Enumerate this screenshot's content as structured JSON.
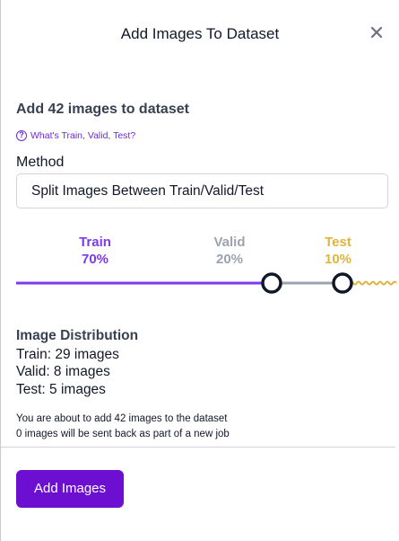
{
  "dialog": {
    "title": "Add Images To Dataset",
    "close_label": "×"
  },
  "heading": "Add 42 images to dataset",
  "help_link": {
    "icon": "?",
    "label": "What's Train, Valid, Test?"
  },
  "method": {
    "label": "Method",
    "selected": "Split Images Between Train/Valid/Test"
  },
  "split": {
    "train": {
      "name": "Train",
      "percent": "70%",
      "value": 70,
      "color": "#7c3aed"
    },
    "valid": {
      "name": "Valid",
      "percent": "20%",
      "value": 20,
      "color": "#9ca3af"
    },
    "test": {
      "name": "Test",
      "percent": "10%",
      "value": 10,
      "color": "#e0b43a"
    }
  },
  "distribution": {
    "title": "Image Distribution",
    "train": "Train: 29 images",
    "valid": "Valid: 8 images",
    "test": "Test: 5 images"
  },
  "notes": {
    "line1": "You are about to add 42 images to the dataset",
    "line2": "0 images will be sent back as part of a new job"
  },
  "actions": {
    "add_label": "Add Images"
  },
  "colors": {
    "accent": "#6d0fd0",
    "link": "#6d28d9"
  }
}
